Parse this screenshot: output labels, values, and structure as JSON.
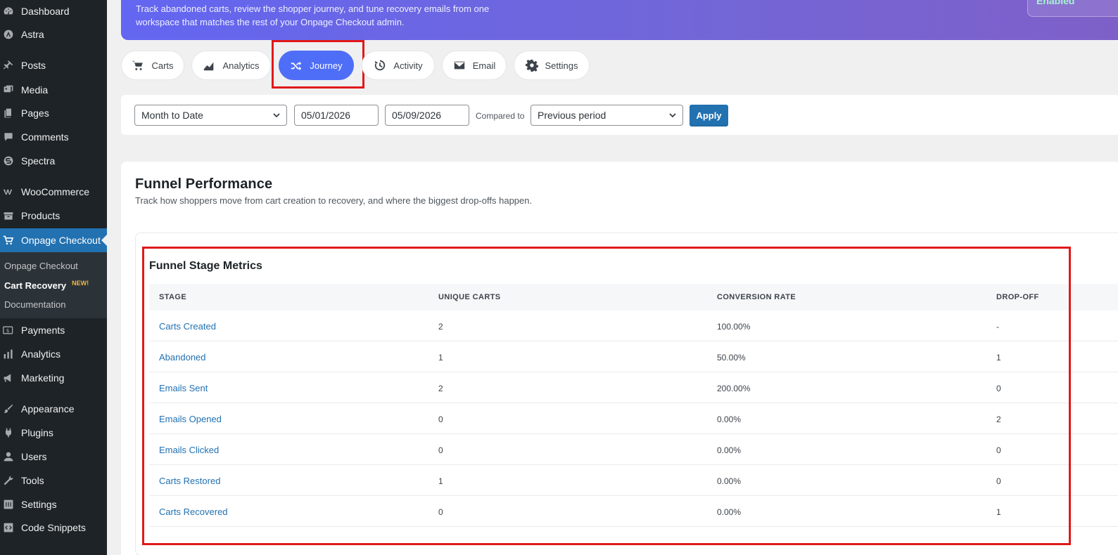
{
  "sidebar": {
    "items": [
      {
        "label": "Dashboard",
        "icon": "dashboard-icon"
      },
      {
        "label": "Astra",
        "icon": "astra-icon"
      },
      {
        "label": "Posts",
        "icon": "pin-icon"
      },
      {
        "label": "Media",
        "icon": "media-icon"
      },
      {
        "label": "Pages",
        "icon": "pages-icon"
      },
      {
        "label": "Comments",
        "icon": "comment-icon"
      },
      {
        "label": "Spectra",
        "icon": "spectra-icon"
      },
      {
        "label": "WooCommerce",
        "icon": "woocommerce-icon"
      },
      {
        "label": "Products",
        "icon": "archive-icon"
      },
      {
        "label": "Onpage Checkout",
        "icon": "cart-icon"
      },
      {
        "label": "Payments",
        "icon": "payments-icon"
      },
      {
        "label": "Analytics",
        "icon": "bar-chart-icon"
      },
      {
        "label": "Marketing",
        "icon": "megaphone-icon"
      },
      {
        "label": "Appearance",
        "icon": "brush-icon"
      },
      {
        "label": "Plugins",
        "icon": "plug-icon"
      },
      {
        "label": "Users",
        "icon": "user-icon"
      },
      {
        "label": "Tools",
        "icon": "wrench-icon"
      },
      {
        "label": "Settings",
        "icon": "settings-icon"
      },
      {
        "label": "Code Snippets",
        "icon": "code-icon"
      }
    ],
    "submenu": [
      {
        "label": "Onpage Checkout"
      },
      {
        "label": "Cart Recovery",
        "badge": "NEW!"
      },
      {
        "label": "Documentation"
      }
    ]
  },
  "header": {
    "description": "Track abandoned carts, review the shopper journey, and tune recovery emails from one workspace that matches the rest of your Onpage Checkout admin.",
    "status": "Enabled"
  },
  "tabs": [
    {
      "label": "Carts",
      "icon": "cart-icon"
    },
    {
      "label": "Analytics",
      "icon": "area-chart-icon"
    },
    {
      "label": "Journey",
      "icon": "shuffle-icon",
      "active": true
    },
    {
      "label": "Activity",
      "icon": "history-icon"
    },
    {
      "label": "Email",
      "icon": "envelope-icon"
    },
    {
      "label": "Settings",
      "icon": "gear-icon"
    }
  ],
  "filters": {
    "range": "Month to Date",
    "start_date": "05/01/2026",
    "end_date": "05/09/2026",
    "compared_label": "Compared to",
    "compare": "Previous period",
    "apply": "Apply"
  },
  "panel": {
    "title": "Funnel Performance",
    "subtitle": "Track how shoppers move from cart creation to recovery, and where the biggest drop-offs happen.",
    "metrics_title": "Funnel Stage Metrics",
    "columns": [
      "STAGE",
      "UNIQUE CARTS",
      "CONVERSION RATE",
      "DROP-OFF"
    ],
    "rows": [
      {
        "stage": "Carts Created",
        "unique": "2",
        "rate": "100.00%",
        "drop": "-"
      },
      {
        "stage": "Abandoned",
        "unique": "1",
        "rate": "50.00%",
        "drop": "1"
      },
      {
        "stage": "Emails Sent",
        "unique": "2",
        "rate": "200.00%",
        "drop": "0"
      },
      {
        "stage": "Emails Opened",
        "unique": "0",
        "rate": "0.00%",
        "drop": "2"
      },
      {
        "stage": "Emails Clicked",
        "unique": "0",
        "rate": "0.00%",
        "drop": "0"
      },
      {
        "stage": "Carts Restored",
        "unique": "1",
        "rate": "0.00%",
        "drop": "0"
      },
      {
        "stage": "Carts Recovered",
        "unique": "0",
        "rate": "0.00%",
        "drop": "1"
      }
    ]
  },
  "colors": {
    "sidebar_bg": "#1d2327",
    "wp_blue": "#2271b1",
    "tab_active": "#4f6ef7",
    "highlight": "#e0191a"
  }
}
